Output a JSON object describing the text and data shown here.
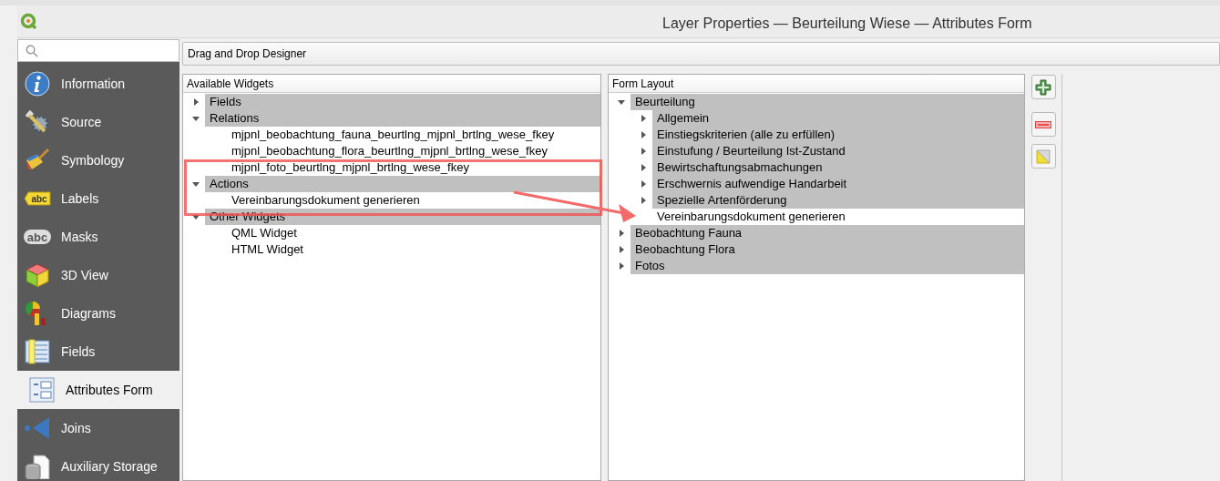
{
  "window": {
    "title": "Layer Properties — Beurteilung Wiese — Attributes Form"
  },
  "sidebar": {
    "items": [
      {
        "label": "Information",
        "selected": false
      },
      {
        "label": "Source",
        "selected": false
      },
      {
        "label": "Symbology",
        "selected": false
      },
      {
        "label": "Labels",
        "selected": false,
        "icon_text": "abc"
      },
      {
        "label": "Masks",
        "selected": false,
        "icon_text": "abc"
      },
      {
        "label": "3D View",
        "selected": false
      },
      {
        "label": "Diagrams",
        "selected": false
      },
      {
        "label": "Fields",
        "selected": false
      },
      {
        "label": "Attributes Form",
        "selected": true
      },
      {
        "label": "Joins",
        "selected": false
      },
      {
        "label": "Auxiliary Storage",
        "selected": false
      }
    ]
  },
  "editor_type": {
    "value": "Drag and Drop Designer"
  },
  "available_widgets": {
    "header": "Available Widgets",
    "tree": [
      {
        "label": "Fields",
        "kind": "group",
        "expanded": false
      },
      {
        "label": "Relations",
        "kind": "group",
        "expanded": true,
        "children": [
          {
            "label": "mjpnl_beobachtung_fauna_beurtlng_mjpnl_brtlng_wese_fkey",
            "kind": "item"
          },
          {
            "label": "mjpnl_beobachtung_flora_beurtlng_mjpnl_brtlng_wese_fkey",
            "kind": "item"
          },
          {
            "label": "mjpnl_foto_beurtlng_mjpnl_brtlng_wese_fkey",
            "kind": "item"
          }
        ]
      },
      {
        "label": "Actions",
        "kind": "group",
        "expanded": true,
        "children": [
          {
            "label": "Vereinbarungsdokument generieren",
            "kind": "item"
          }
        ]
      },
      {
        "label": "Other Widgets",
        "kind": "group",
        "expanded": true,
        "children": [
          {
            "label": "QML Widget",
            "kind": "item"
          },
          {
            "label": "HTML Widget",
            "kind": "item"
          }
        ]
      }
    ]
  },
  "form_layout": {
    "header": "Form Layout",
    "tree": [
      {
        "label": "Beurteilung",
        "kind": "group",
        "expanded": true,
        "children": [
          {
            "label": "Allgemein",
            "kind": "group",
            "expanded": false
          },
          {
            "label": "Einstiegskriterien (alle zu erfüllen)",
            "kind": "group",
            "expanded": false
          },
          {
            "label": "Einstufung / Beurteilung Ist-Zustand",
            "kind": "group",
            "expanded": false
          },
          {
            "label": "Bewirtschaftungsabmachungen",
            "kind": "group",
            "expanded": false
          },
          {
            "label": "Erschwernis aufwendige Handarbeit",
            "kind": "group",
            "expanded": false
          },
          {
            "label": "Spezielle Artenförderung",
            "kind": "group",
            "expanded": false
          },
          {
            "label": "Vereinbarungsdokument generieren",
            "kind": "item"
          }
        ]
      },
      {
        "label": "Beobachtung Fauna",
        "kind": "group",
        "expanded": false
      },
      {
        "label": "Beobachtung Flora",
        "kind": "group",
        "expanded": false
      },
      {
        "label": "Fotos",
        "kind": "group",
        "expanded": false
      }
    ]
  }
}
